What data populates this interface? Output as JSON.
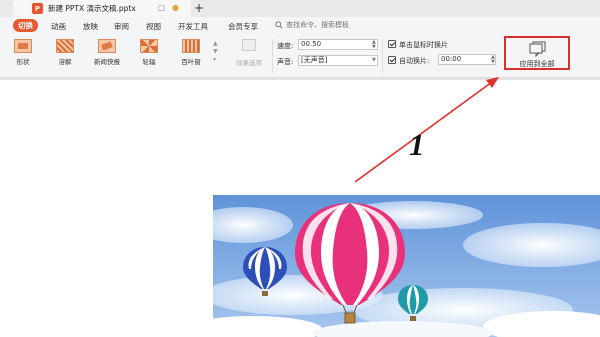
{
  "titlebar": {
    "doc_title": "新建 PPTX 演示文稿.pptx",
    "app_icon": "P",
    "new_tab": "+"
  },
  "menu": {
    "items": [
      "切换",
      "动画",
      "放映",
      "审阅",
      "视图",
      "开发工具",
      "会员专享"
    ],
    "active": "切换",
    "search_placeholder": "查找命令、搜索模板"
  },
  "ribbon": {
    "transitions": [
      "形状",
      "溶解",
      "新闻快报",
      "轮辐",
      "百叶窗"
    ],
    "effect_options": "效果选项",
    "speed_label": "速度:",
    "speed_value": "00.50",
    "sound_label": "声音:",
    "sound_value": "[无声音]",
    "on_click_label": "单击鼠标时换片",
    "auto_label": "自动换片:",
    "auto_value": "00:00",
    "apply_all": "应用到全部"
  },
  "annotation": {
    "number": "1"
  },
  "colors": {
    "accent": "#e8562e",
    "highlight": "#d9302c"
  }
}
